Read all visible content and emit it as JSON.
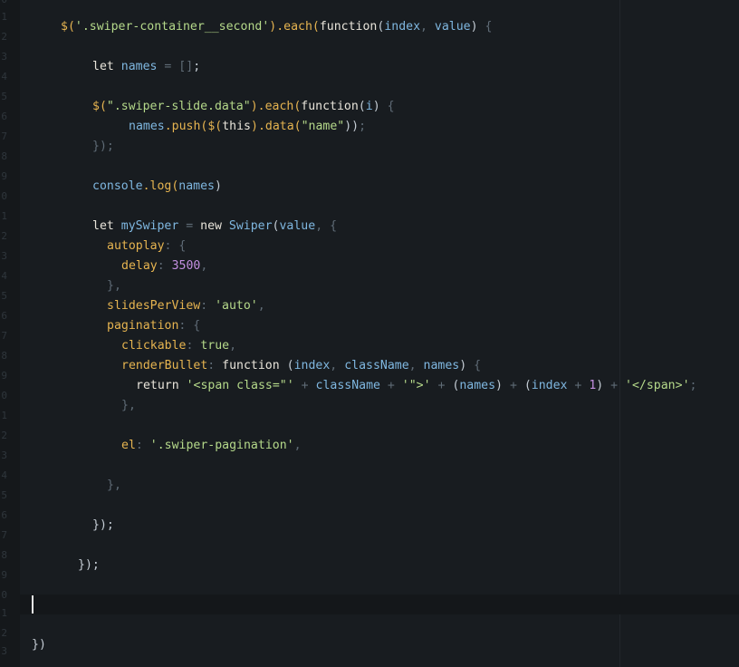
{
  "editor": {
    "line_numbers": [
      "0",
      "1",
      "2",
      "3",
      "4",
      "5",
      "6",
      "7",
      "8",
      "9",
      "0",
      "1",
      "2",
      "3",
      "4",
      "5",
      "6",
      "7",
      "8",
      "9",
      "0",
      "1",
      "2",
      "3",
      "4",
      "5",
      "6",
      "7",
      "8",
      "9",
      "0",
      "1",
      "2",
      "3"
    ],
    "lines": [
      [
        [
          "fn",
          "$("
        ],
        [
          "str",
          "'.swiper-container__second'"
        ],
        [
          "fn",
          ").each("
        ],
        [
          "kw",
          "function"
        ],
        [
          "pl",
          "("
        ],
        [
          "var",
          "index"
        ],
        [
          "pu",
          ", "
        ],
        [
          "var",
          "value"
        ],
        [
          "pl",
          ") "
        ],
        [
          "pu",
          "{"
        ]
      ],
      [],
      [
        [
          "kw",
          "let "
        ],
        [
          "var",
          "names"
        ],
        [
          "pu",
          " = "
        ],
        [
          "pu",
          "[]"
        ],
        [
          "pl",
          ";"
        ]
      ],
      [],
      [
        [
          "fn",
          "$("
        ],
        [
          "str",
          "\".swiper-slide.data\""
        ],
        [
          "fn",
          ").each("
        ],
        [
          "kw",
          "function"
        ],
        [
          "pl",
          "("
        ],
        [
          "var",
          "i"
        ],
        [
          "pl",
          ") "
        ],
        [
          "pu",
          "{"
        ]
      ],
      [
        [
          "var",
          "names"
        ],
        [
          "fn",
          ".push("
        ],
        [
          "fn",
          "$("
        ],
        [
          "kw",
          "this"
        ],
        [
          "fn",
          ")"
        ],
        [
          "fn",
          ".data("
        ],
        [
          "str",
          "\"name\""
        ],
        [
          "pl",
          "))"
        ],
        [
          "pu",
          ";"
        ]
      ],
      [
        [
          "pu",
          "});"
        ]
      ],
      [],
      [
        [
          "var",
          "console"
        ],
        [
          "fn",
          ".log("
        ],
        [
          "var",
          "names"
        ],
        [
          "pl",
          ")"
        ]
      ],
      [],
      [
        [
          "kw",
          "let "
        ],
        [
          "var",
          "mySwiper"
        ],
        [
          "pu",
          " = "
        ],
        [
          "kw",
          "new "
        ],
        [
          "var",
          "Swiper"
        ],
        [
          "pl",
          "("
        ],
        [
          "var",
          "value"
        ],
        [
          "pu",
          ", "
        ],
        [
          "pu",
          "{"
        ]
      ],
      [
        [
          "fn",
          "autoplay"
        ],
        [
          "pu",
          ": {"
        ]
      ],
      [
        [
          "fn",
          "delay"
        ],
        [
          "pu",
          ": "
        ],
        [
          "num",
          "3500"
        ],
        [
          "pu",
          ","
        ]
      ],
      [
        [
          "pu",
          "},"
        ]
      ],
      [
        [
          "fn",
          "slidesPerView"
        ],
        [
          "pu",
          ": "
        ],
        [
          "str",
          "'auto'"
        ],
        [
          "pu",
          ","
        ]
      ],
      [
        [
          "fn",
          "pagination"
        ],
        [
          "pu",
          ": {"
        ]
      ],
      [
        [
          "fn",
          "clickable"
        ],
        [
          "pu",
          ": "
        ],
        [
          "str",
          "true"
        ],
        [
          "pu",
          ","
        ]
      ],
      [
        [
          "fn",
          "renderBullet"
        ],
        [
          "pu",
          ": "
        ],
        [
          "kw",
          "function "
        ],
        [
          "pl",
          "("
        ],
        [
          "var",
          "index"
        ],
        [
          "pu",
          ", "
        ],
        [
          "var",
          "className"
        ],
        [
          "pu",
          ", "
        ],
        [
          "var",
          "names"
        ],
        [
          "pl",
          ") "
        ],
        [
          "pu",
          "{"
        ]
      ],
      [
        [
          "kw",
          "return "
        ],
        [
          "str",
          "'<span class=\"'"
        ],
        [
          "pu",
          " + "
        ],
        [
          "var",
          "className"
        ],
        [
          "pu",
          " + "
        ],
        [
          "str",
          "'\">'"
        ],
        [
          "pu",
          " + "
        ],
        [
          "pl",
          "("
        ],
        [
          "var",
          "names"
        ],
        [
          "pl",
          ")"
        ],
        [
          "pu",
          " + "
        ],
        [
          "pl",
          "("
        ],
        [
          "var",
          "index"
        ],
        [
          "pu",
          " + "
        ],
        [
          "num",
          "1"
        ],
        [
          "pl",
          ")"
        ],
        [
          "pu",
          " + "
        ],
        [
          "str",
          "'</span>'"
        ],
        [
          "pu",
          ";"
        ]
      ],
      [
        [
          "pu",
          "},"
        ]
      ],
      [],
      [
        [
          "fn",
          "el"
        ],
        [
          "pu",
          ": "
        ],
        [
          "str",
          "'.swiper-pagination'"
        ],
        [
          "pu",
          ","
        ]
      ],
      [],
      [
        [
          "pu",
          "},"
        ]
      ],
      [],
      [
        [
          "pl",
          "});"
        ]
      ],
      [],
      [
        [
          "pl",
          "});"
        ]
      ],
      [],
      [],
      [],
      [
        [
          "pl",
          "})"
        ]
      ]
    ]
  }
}
